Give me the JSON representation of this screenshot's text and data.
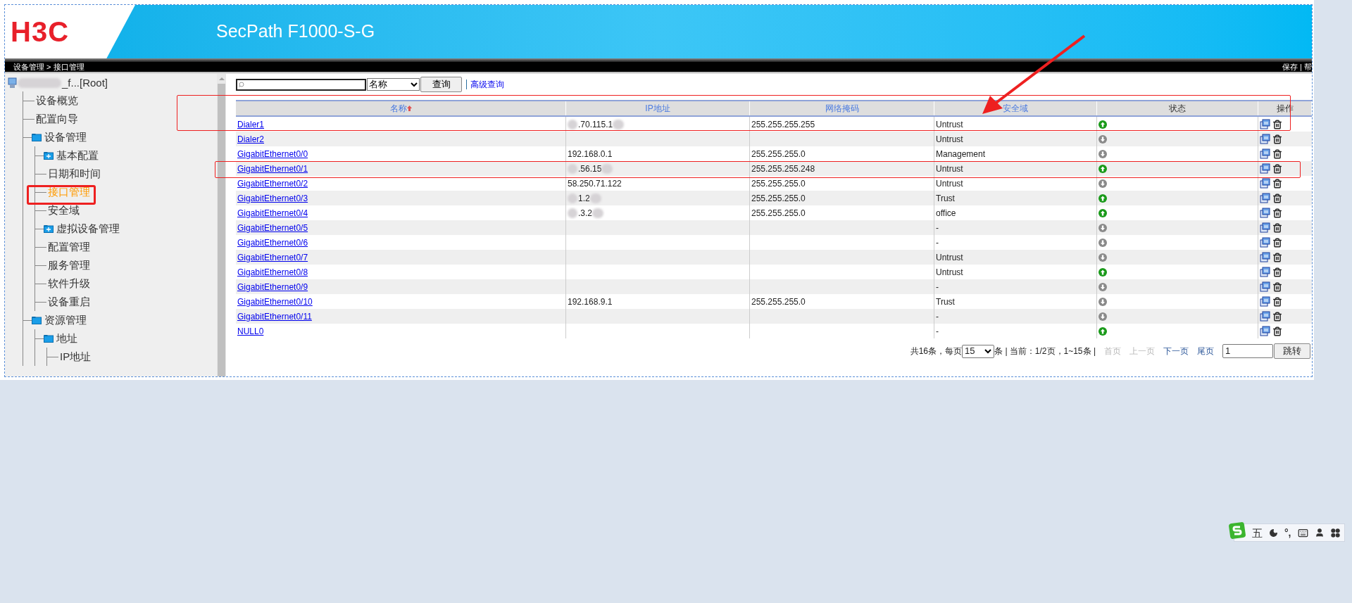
{
  "header": {
    "logo": "H3C",
    "product": "SecPath F1000-S-G"
  },
  "breadcrumb": "设备管理 > 接口管理",
  "top_links": "保存 | 帮",
  "sidebar": {
    "root": "_f...[Root]",
    "items": [
      {
        "label": "设备概览",
        "kind": "leaf",
        "selected": false
      },
      {
        "label": "配置向导",
        "kind": "leaf",
        "selected": false
      },
      {
        "label": "设备管理",
        "kind": "folder",
        "expanded": true,
        "selected": false,
        "children": [
          {
            "label": "基本配置",
            "kind": "folder",
            "expanded": false,
            "selected": false
          },
          {
            "label": "日期和时间",
            "kind": "leaf",
            "selected": false
          },
          {
            "label": "接口管理",
            "kind": "leaf",
            "selected": true
          },
          {
            "label": "安全域",
            "kind": "leaf",
            "selected": false
          },
          {
            "label": "虚拟设备管理",
            "kind": "folder",
            "expanded": false,
            "selected": false
          },
          {
            "label": "配置管理",
            "kind": "leaf",
            "selected": false
          },
          {
            "label": "服务管理",
            "kind": "leaf",
            "selected": false
          },
          {
            "label": "软件升级",
            "kind": "leaf",
            "selected": false
          },
          {
            "label": "设备重启",
            "kind": "leaf",
            "selected": false
          }
        ]
      },
      {
        "label": "资源管理",
        "kind": "folder",
        "expanded": true,
        "selected": false,
        "children": [
          {
            "label": "地址",
            "kind": "folder",
            "expanded": true,
            "selected": false,
            "children": [
              {
                "label": "IP地址",
                "kind": "leaf",
                "selected": false
              }
            ]
          }
        ]
      }
    ]
  },
  "search": {
    "select": "名称",
    "button": "查询",
    "advanced_link": "高级查询"
  },
  "table": {
    "columns": [
      {
        "label": "名称",
        "sortable": true,
        "sorted": true
      },
      {
        "label": "IP地址",
        "sortable": true,
        "sorted": false
      },
      {
        "label": "网络掩码",
        "sortable": true,
        "sorted": false
      },
      {
        "label": "安全域",
        "sortable": true,
        "sorted": false
      },
      {
        "label": "状态",
        "sortable": false,
        "sorted": false
      },
      {
        "label": "操作",
        "sortable": false,
        "sorted": false
      }
    ],
    "rows": [
      {
        "name": "Dialer1",
        "ip": ".70.115.1",
        "ip_redacted": true,
        "mask": "255.255.255.255",
        "zone": "Untrust",
        "up": true
      },
      {
        "name": "Dialer2",
        "zone": "Untrust",
        "up": false
      },
      {
        "name": "GigabitEthernet0/0",
        "ip": "192.168.0.1",
        "ip_redacted": false,
        "mask": "255.255.255.0",
        "zone": "Management",
        "up": false
      },
      {
        "name": "GigabitEthernet0/1",
        "ip": ".56.15",
        "ip_redacted": true,
        "mask": "255.255.255.248",
        "zone": "Untrust",
        "up": true
      },
      {
        "name": "GigabitEthernet0/2",
        "ip": "58.250.71.122",
        "ip_redacted": false,
        "mask": "255.255.255.0",
        "zone": "Untrust",
        "up": false
      },
      {
        "name": "GigabitEthernet0/3",
        "ip": "1.2",
        "ip_redacted": true,
        "mask": "255.255.255.0",
        "zone": "Trust",
        "up": true
      },
      {
        "name": "GigabitEthernet0/4",
        "ip": ".3.2",
        "ip_redacted": true,
        "mask": "255.255.255.0",
        "zone": "office",
        "up": true
      },
      {
        "name": "GigabitEthernet0/5",
        "zone": "-",
        "up": false
      },
      {
        "name": "GigabitEthernet0/6",
        "zone": "-",
        "up": false
      },
      {
        "name": "GigabitEthernet0/7",
        "zone": "Untrust",
        "up": false
      },
      {
        "name": "GigabitEthernet0/8",
        "zone": "Untrust",
        "up": true
      },
      {
        "name": "GigabitEthernet0/9",
        "zone": "-",
        "up": false
      },
      {
        "name": "GigabitEthernet0/10",
        "ip": "192.168.9.1",
        "ip_redacted": false,
        "mask": "255.255.255.0",
        "zone": "Trust",
        "up": false
      },
      {
        "name": "GigabitEthernet0/11",
        "zone": "-",
        "up": false
      },
      {
        "name": "NULL0",
        "zone": "-",
        "up": true
      }
    ]
  },
  "pagination": {
    "prefix": "共16条，每页",
    "page_size": "15",
    "summary": "条 | 当前：1/2页，1~15条 |",
    "links": [
      {
        "label": "首页",
        "disabled": true
      },
      {
        "label": "上一页",
        "disabled": true
      },
      {
        "label": "下一页",
        "disabled": false
      },
      {
        "label": "尾页",
        "disabled": false
      }
    ],
    "page_input": "1",
    "go_button": "跳转"
  },
  "ime_toolbar": {
    "mode": "五",
    "punct": "°,"
  }
}
